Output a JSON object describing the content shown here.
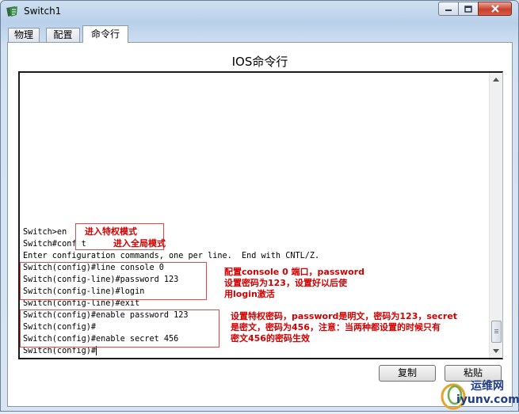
{
  "window": {
    "title": "Switch1",
    "controls": {
      "minimize": "minimize-icon",
      "maximize": "maximize-icon",
      "close": "close-icon"
    }
  },
  "tabs": [
    {
      "label": "物理",
      "active": false
    },
    {
      "label": "配置",
      "active": false
    },
    {
      "label": "命令行",
      "active": true
    }
  ],
  "panel": {
    "title": "IOS命令行"
  },
  "terminal": {
    "lines": [
      "Switch>en",
      "Switch#conf t",
      "Enter configuration commands, one per line.  End with CNTL/Z.",
      "Switch(config)#line console 0",
      "Switch(config-line)#password 123",
      "Switch(config-line)#login",
      "Switch(config-line)#exit",
      "Switch(config)#enable password 123",
      "Switch(config)#",
      "Switch(config)#enable secret 456",
      "Switch(config)#"
    ]
  },
  "annotations": {
    "enable": "进入特权模式",
    "conf_t": "进入全局模式",
    "console": "配置console 0 端口，password\n设置密码为123，设置好以后使\n用login激活",
    "secret": "设置特权密码，password是明文，密码为123，secret\n是密文，密码为456，注意：当两种都设置的时候只有\n密文456的密码生效"
  },
  "buttons": {
    "copy": "复制",
    "paste": "粘贴"
  },
  "watermark": {
    "line1": "运维网",
    "line2": "iyunv.com"
  },
  "colors": {
    "annotation": "#d40000",
    "titlebar": "#b9d0ea",
    "close": "#c7402d"
  }
}
